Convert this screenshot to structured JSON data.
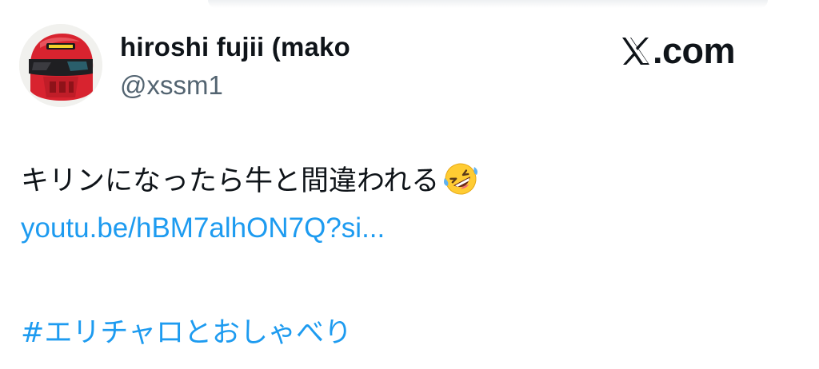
{
  "author": {
    "display_name": "hiroshi fujii (mako",
    "handle": "@xssm1",
    "avatar_icon": "helmet-avatar-icon"
  },
  "brand": {
    "text": ".com",
    "logo_icon": "x-logo-icon"
  },
  "tweet": {
    "text": "キリンになったら牛と間違われる",
    "emoji": "rolling-on-floor-laughing-emoji",
    "link": "youtu.be/hBM7alhON7Q?si...",
    "hashtag": "#エリチャロとおしゃべり"
  },
  "colors": {
    "text": "#0f1419",
    "secondary": "#536471",
    "link": "#1d9bf0",
    "helmet": "#d8232f"
  }
}
